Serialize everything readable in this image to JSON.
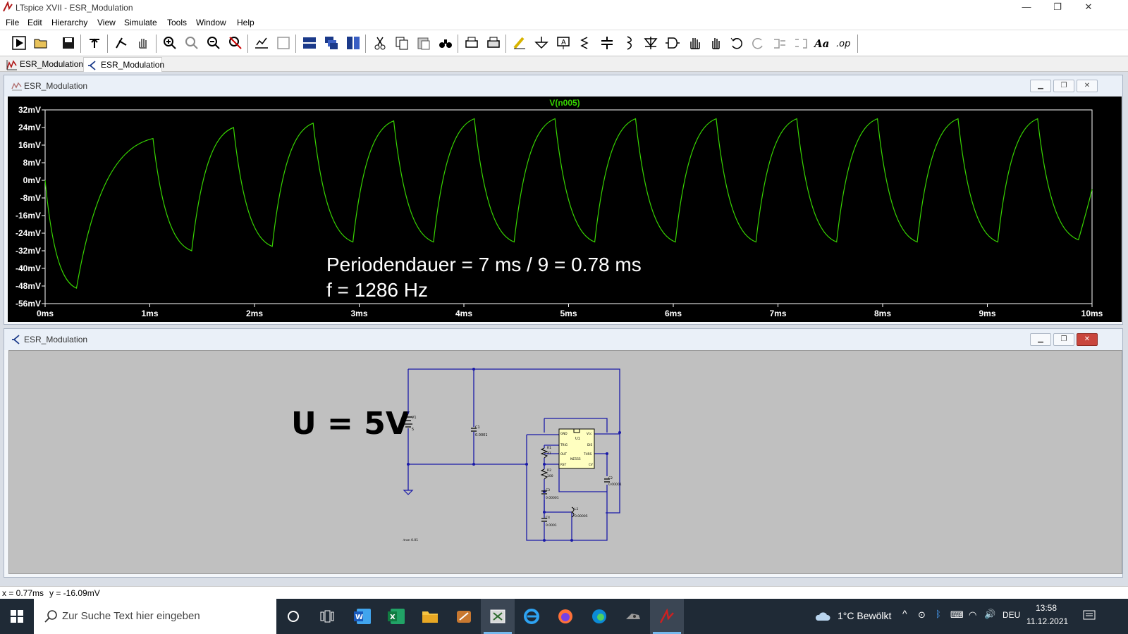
{
  "window": {
    "title": "LTspice XVII - ESR_Modulation",
    "min": "—",
    "restore": "❐",
    "close": "✕"
  },
  "menu": [
    "File",
    "Edit",
    "Hierarchy",
    "View",
    "Simulate",
    "Tools",
    "Window",
    "Help"
  ],
  "toolbar_icons": [
    "run-icon",
    "open-icon",
    "save-icon",
    "control-panel-icon",
    "halt-icon",
    "pan-icon",
    "zoom-in-icon",
    "zoom-full-icon",
    "zoom-out-icon",
    "zoom-cancel-icon",
    "autorange-icon",
    "marker-icon",
    "tile-horizontal-icon",
    "cascade-icon",
    "tile-vertical-icon",
    "cut-icon",
    "copy-icon",
    "paste-icon",
    "find-icon",
    "print-preview-icon",
    "print-icon",
    "wire-icon",
    "ground-icon",
    "label-icon",
    "resistor-icon",
    "capacitor-icon",
    "inductor-icon",
    "diode-icon",
    "component-icon",
    "move-icon",
    "drag-icon",
    "undo-icon",
    "redo-icon",
    "rotate-icon",
    "mirror-icon",
    "text-icon",
    "spice-directive-icon"
  ],
  "tabs": [
    {
      "label": "ESR_Modulation",
      "icon": "waveform-icon"
    },
    {
      "label": "ESR_Modulation",
      "icon": "schematic-icon"
    }
  ],
  "plot": {
    "title": "ESR_Modulation",
    "trace_label": "V(n005)",
    "annotation_line1": "Periodendauer = 7 ms / 9 = 0.78 ms",
    "annotation_line2": "f = 1286 Hz",
    "trace_color": "#37d400"
  },
  "chart_data": {
    "type": "line",
    "series": [
      {
        "name": "V(n005)",
        "color": "#37d400"
      }
    ],
    "x_ticks": [
      "0ms",
      "1ms",
      "2ms",
      "3ms",
      "4ms",
      "5ms",
      "6ms",
      "7ms",
      "8ms",
      "9ms",
      "10ms"
    ],
    "y_ticks": [
      "32mV",
      "24mV",
      "16mV",
      "8mV",
      "0mV",
      "-8mV",
      "-16mV",
      "-24mV",
      "-32mV",
      "-40mV",
      "-48mV",
      "-56mV"
    ],
    "xlim": [
      0,
      10
    ],
    "ylim": [
      -56,
      32
    ],
    "xunit": "ms",
    "yunit": "mV",
    "peaks": [
      {
        "t": 1.03,
        "v": 19
      },
      {
        "t": 1.8,
        "v": 24
      },
      {
        "t": 2.56,
        "v": 26
      },
      {
        "t": 3.33,
        "v": 27
      },
      {
        "t": 4.1,
        "v": 28
      },
      {
        "t": 4.87,
        "v": 28
      },
      {
        "t": 5.64,
        "v": 28
      },
      {
        "t": 6.41,
        "v": 28
      },
      {
        "t": 7.18,
        "v": 28
      },
      {
        "t": 7.95,
        "v": 28
      },
      {
        "t": 8.72,
        "v": 28
      },
      {
        "t": 9.48,
        "v": 28
      }
    ],
    "troughs": [
      {
        "t": 0.3,
        "v": -49
      },
      {
        "t": 1.4,
        "v": -32
      },
      {
        "t": 2.17,
        "v": -30
      },
      {
        "t": 2.94,
        "v": -28
      },
      {
        "t": 3.71,
        "v": -28
      },
      {
        "t": 4.48,
        "v": -28
      },
      {
        "t": 5.25,
        "v": -28
      },
      {
        "t": 6.02,
        "v": -28
      },
      {
        "t": 6.79,
        "v": -28
      },
      {
        "t": 7.56,
        "v": -28
      },
      {
        "t": 8.33,
        "v": -28
      },
      {
        "t": 9.1,
        "v": -28
      },
      {
        "t": 9.87,
        "v": -27
      }
    ]
  },
  "schematic": {
    "title": "ESR_Modulation",
    "big_label": "U = 5V",
    "v1_name": "V1",
    "v1_value": "5",
    "c1_name": "C1",
    "c1_value": "0.0001",
    "u1_name": "U1",
    "u1_part": "NE555",
    "pins": {
      "gnd": "GND",
      "vcc": "Vcc",
      "trig": "TRIG",
      "dis": "DIS",
      "out": "OUT",
      "thrs": "THRS",
      "rst": "RST",
      "cv": "CV"
    },
    "r1_name": "R1",
    "r1_value": "47",
    "r2_name": "R2",
    "r2_value": "100",
    "c2_name": "C2",
    "c2_value": "0.00001",
    "c3_name": "C3",
    "c3_value": "0.00001",
    "c4_name": "C4",
    "c4_value": "0.0001",
    "l1_name": "L1",
    "l1_value": "0.00005",
    "directive": ".tran 0.01"
  },
  "status": {
    "x": "x = 0.77ms",
    "y": "y = -16.09mV"
  },
  "taskbar": {
    "search_placeholder": "Zur Suche Text hier eingeben",
    "weather": "1°C  Bewölkt",
    "lang": "DEU",
    "time": "13:58",
    "date": "11.12.2021"
  }
}
